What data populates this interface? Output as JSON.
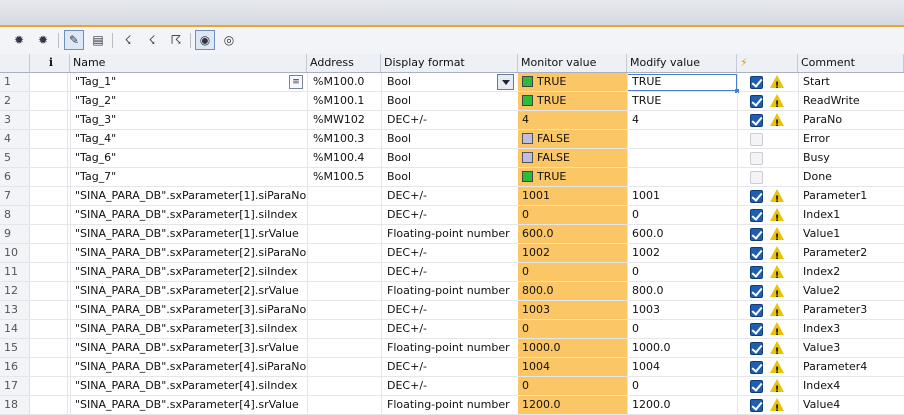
{
  "toolbar": {
    "buttons": [
      {
        "name": "insert-row-icon",
        "glyph": "✹"
      },
      {
        "name": "add-row-icon",
        "glyph": "✹"
      },
      {
        "name": "modify-now-icon",
        "glyph": "✎"
      },
      {
        "name": "modify-trigger-icon",
        "glyph": "▤"
      },
      {
        "name": "force-value-icon",
        "glyph": "☇"
      },
      {
        "name": "force-trigger-icon",
        "glyph": "☇"
      },
      {
        "name": "stop-forcing-icon",
        "glyph": "☈"
      },
      {
        "name": "monitor-all-icon",
        "glyph": "◉"
      },
      {
        "name": "monitor-now-icon",
        "glyph": "◎"
      }
    ]
  },
  "columns": {
    "num": "",
    "info": "i",
    "name": "Name",
    "address": "Address",
    "format": "Display format",
    "monitor": "Monitor value",
    "modify": "Modify value",
    "force": "⚡",
    "comment": "Comment"
  },
  "colors": {
    "monitor_bg": "#fac666",
    "status_true": "#2bbd3a",
    "status_false": "#bcbde0",
    "accent_line": "#e8a531",
    "checkbox_on": "#1f5fb0",
    "warning": "#e9c20a"
  },
  "rows": [
    {
      "num": "1",
      "name": "\"Tag_1\"",
      "address": "%M100.0",
      "format": "Bool",
      "monitor": "TRUE",
      "status": "on",
      "modify": "TRUE",
      "checked": true,
      "warn": true,
      "comment": "Start"
    },
    {
      "num": "2",
      "name": "\"Tag_2\"",
      "address": "%M100.1",
      "format": "Bool",
      "monitor": "TRUE",
      "status": "on",
      "modify": "TRUE",
      "checked": true,
      "warn": true,
      "comment": "ReadWrite"
    },
    {
      "num": "3",
      "name": "\"Tag_3\"",
      "address": "%MW102",
      "format": "DEC+/-",
      "monitor": "4",
      "status": "",
      "modify": "4",
      "checked": true,
      "warn": true,
      "comment": "ParaNo"
    },
    {
      "num": "4",
      "name": "\"Tag_4\"",
      "address": "%M100.3",
      "format": "Bool",
      "monitor": "FALSE",
      "status": "off",
      "modify": "",
      "checked": false,
      "warn": false,
      "comment": "Error"
    },
    {
      "num": "5",
      "name": "\"Tag_6\"",
      "address": "%M100.4",
      "format": "Bool",
      "monitor": "FALSE",
      "status": "off",
      "modify": "",
      "checked": false,
      "warn": false,
      "comment": "Busy"
    },
    {
      "num": "6",
      "name": "\"Tag_7\"",
      "address": "%M100.5",
      "format": "Bool",
      "monitor": "TRUE",
      "status": "on",
      "modify": "",
      "checked": false,
      "warn": false,
      "comment": "Done"
    },
    {
      "num": "7",
      "name": "\"SINA_PARA_DB\".sxParameter[1].siParaNo",
      "address": "",
      "format": "DEC+/-",
      "monitor": "1001",
      "status": "",
      "modify": "1001",
      "checked": true,
      "warn": true,
      "comment": "Parameter1"
    },
    {
      "num": "8",
      "name": "\"SINA_PARA_DB\".sxParameter[1].siIndex",
      "address": "",
      "format": "DEC+/-",
      "monitor": "0",
      "status": "",
      "modify": "0",
      "checked": true,
      "warn": true,
      "comment": "Index1"
    },
    {
      "num": "9",
      "name": "\"SINA_PARA_DB\".sxParameter[1].srValue",
      "address": "",
      "format": "Floating-point number",
      "monitor": "600.0",
      "status": "",
      "modify": "600.0",
      "checked": true,
      "warn": true,
      "comment": "Value1"
    },
    {
      "num": "10",
      "name": "\"SINA_PARA_DB\".sxParameter[2].siParaNo",
      "address": "",
      "format": "DEC+/-",
      "monitor": "1002",
      "status": "",
      "modify": "1002",
      "checked": true,
      "warn": true,
      "comment": "Parameter2"
    },
    {
      "num": "11",
      "name": "\"SINA_PARA_DB\".sxParameter[2].siIndex",
      "address": "",
      "format": "DEC+/-",
      "monitor": "0",
      "status": "",
      "modify": "0",
      "checked": true,
      "warn": true,
      "comment": "Index2"
    },
    {
      "num": "12",
      "name": "\"SINA_PARA_DB\".sxParameter[2].srValue",
      "address": "",
      "format": "Floating-point number",
      "monitor": "800.0",
      "status": "",
      "modify": "800.0",
      "checked": true,
      "warn": true,
      "comment": "Value2"
    },
    {
      "num": "13",
      "name": "\"SINA_PARA_DB\".sxParameter[3].siParaNo",
      "address": "",
      "format": "DEC+/-",
      "monitor": "1003",
      "status": "",
      "modify": "1003",
      "checked": true,
      "warn": true,
      "comment": "Parameter3"
    },
    {
      "num": "14",
      "name": "\"SINA_PARA_DB\".sxParameter[3].siIndex",
      "address": "",
      "format": "DEC+/-",
      "monitor": "0",
      "status": "",
      "modify": "0",
      "checked": true,
      "warn": true,
      "comment": "Index3"
    },
    {
      "num": "15",
      "name": "\"SINA_PARA_DB\".sxParameter[3].srValue",
      "address": "",
      "format": "Floating-point number",
      "monitor": "1000.0",
      "status": "",
      "modify": "1000.0",
      "checked": true,
      "warn": true,
      "comment": "Value3"
    },
    {
      "num": "16",
      "name": "\"SINA_PARA_DB\".sxParameter[4].siParaNo",
      "address": "",
      "format": "DEC+/-",
      "monitor": "1004",
      "status": "",
      "modify": "1004",
      "checked": true,
      "warn": true,
      "comment": "Parameter4"
    },
    {
      "num": "17",
      "name": "\"SINA_PARA_DB\".sxParameter[4].siIndex",
      "address": "",
      "format": "DEC+/-",
      "monitor": "0",
      "status": "",
      "modify": "0",
      "checked": true,
      "warn": true,
      "comment": "Index4"
    },
    {
      "num": "18",
      "name": "\"SINA_PARA_DB\".sxParameter[4].srValue",
      "address": "",
      "format": "Floating-point number",
      "monitor": "1200.0",
      "status": "",
      "modify": "1200.0",
      "checked": true,
      "warn": true,
      "comment": "Value4"
    }
  ]
}
